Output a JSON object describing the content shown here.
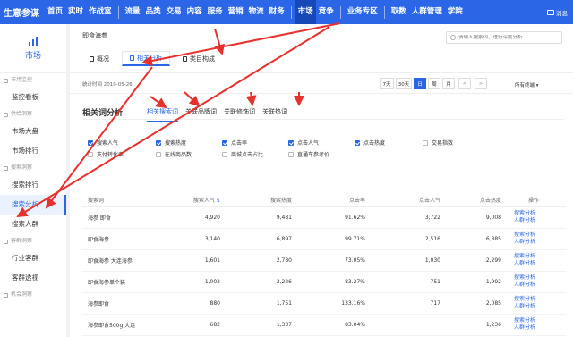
{
  "topnav": {
    "logo": "生意参谋",
    "items": [
      "首页",
      "实时",
      "作战室",
      "流量",
      "品类",
      "交易",
      "内容",
      "服务",
      "营销",
      "物流",
      "财务",
      "市场",
      "竞争",
      "业务专区",
      "取数",
      "人群管理",
      "学院"
    ],
    "active": "市场",
    "message": "消息"
  },
  "sidebar": {
    "title": "市场",
    "groups": [
      {
        "label": "市场监控",
        "items": [
          "监控看板"
        ]
      },
      {
        "label": "供给洞察",
        "items": [
          "市场大盘",
          "市场排行"
        ]
      },
      {
        "label": "搜索洞察",
        "items": [
          "搜索排行",
          "搜索分析",
          "搜索人群"
        ]
      },
      {
        "label": "客群洞察",
        "items": [
          "行业客群",
          "客群透视"
        ]
      },
      {
        "label": "机会洞察",
        "items": []
      }
    ],
    "active": "搜索分析"
  },
  "main": {
    "crumb": "即食海参",
    "search_placeholder": "请输入搜索词，进行深度分析",
    "tabs": [
      "概况",
      "相关分析",
      "类目构成"
    ],
    "active_tab": "相关分析",
    "stat_time": "统计时间 2019-05-26",
    "periods": [
      "7天",
      "30天",
      "日",
      "周",
      "月"
    ],
    "active_period": "日",
    "prev": "<",
    "next": ">",
    "terminal": "所有终端",
    "section_title": "相关词分析",
    "subtabs": [
      "相关搜索词",
      "关联品牌词",
      "关联修饰词",
      "关联热词"
    ],
    "active_subtab": "相关搜索词",
    "checks": [
      {
        "label": "搜索人气",
        "checked": true
      },
      {
        "label": "搜索热度",
        "checked": true
      },
      {
        "label": "点击率",
        "checked": true
      },
      {
        "label": "点击人气",
        "checked": true
      },
      {
        "label": "点击热度",
        "checked": true
      },
      {
        "label": "交易指数",
        "checked": false
      },
      {
        "label": "支付转化率",
        "checked": false
      },
      {
        "label": "在线商品数",
        "checked": false
      },
      {
        "label": "商城点击占比",
        "checked": false
      },
      {
        "label": "直通车参考价",
        "checked": false
      }
    ],
    "table": {
      "headers": [
        "搜索词",
        "搜索人气",
        "搜索热度",
        "点击率",
        "点击人气",
        "点击热度",
        "操作"
      ],
      "sort_mark": "⇅",
      "op1": "搜索分析",
      "op2": "人群分析",
      "rows": [
        [
          "海参 即食",
          "4,920",
          "9,481",
          "91.62%",
          "3,722",
          "9,008"
        ],
        [
          "即食海参",
          "3,140",
          "6,897",
          "99.71%",
          "2,516",
          "6,885"
        ],
        [
          "即食海参 大连海参",
          "1,601",
          "2,780",
          "73.05%",
          "1,030",
          "2,299"
        ],
        [
          "即食海参单个装",
          "1,002",
          "2,226",
          "83.27%",
          "751",
          "1,992"
        ],
        [
          "海参即食",
          "880",
          "1,751",
          "133.16%",
          "717",
          "2,085"
        ],
        [
          "海参即食500g 大连",
          "682",
          "1,337",
          "83.04%",
          "",
          "1,236"
        ]
      ]
    }
  }
}
